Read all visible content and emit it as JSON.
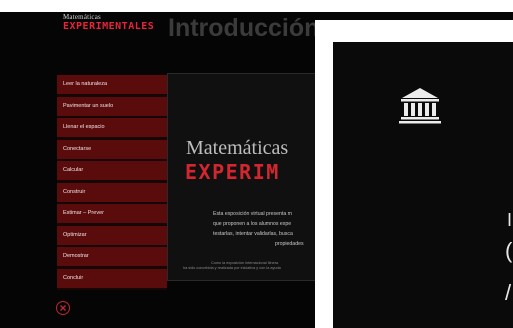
{
  "header": {
    "logo_top": "Matemáticas",
    "logo_bottom": "EXPERIMENTALES",
    "title": "Introducción"
  },
  "menu": {
    "items": [
      {
        "label": "Leer la naturaleza"
      },
      {
        "label": "Pavimentar un suelo"
      },
      {
        "label": "Llenar el espacio"
      },
      {
        "label": "Conectarse"
      },
      {
        "label": "Calcular"
      },
      {
        "label": "Construir"
      },
      {
        "label": "Estimar – Prever"
      },
      {
        "label": "Optimizar"
      },
      {
        "label": "Demostrar"
      },
      {
        "label": "Concluir"
      }
    ]
  },
  "card": {
    "title": "Matemáticas",
    "brand": "EXPERIM",
    "desc_lines": [
      "Esta exposición virtual presenta m",
      "que proponen a los alumnos expe",
      "testarlas, intentar validarlas, busca",
      "propiedades"
    ],
    "note_lines": [
      "Como la exposición internacional itinera",
      "ha sido concebida y realizada por iniciativa y con la ayuda"
    ]
  },
  "overlay": {
    "right_glyphs": [
      "I",
      "(",
      "/"
    ]
  },
  "colors": {
    "background": "#050505",
    "menu_item": "#5a0b0b",
    "brand_red": "#d3262f",
    "overlay_frame": "#ffffff"
  },
  "icons": {
    "close": "close-circle-icon",
    "unesco": "temple-icon"
  }
}
